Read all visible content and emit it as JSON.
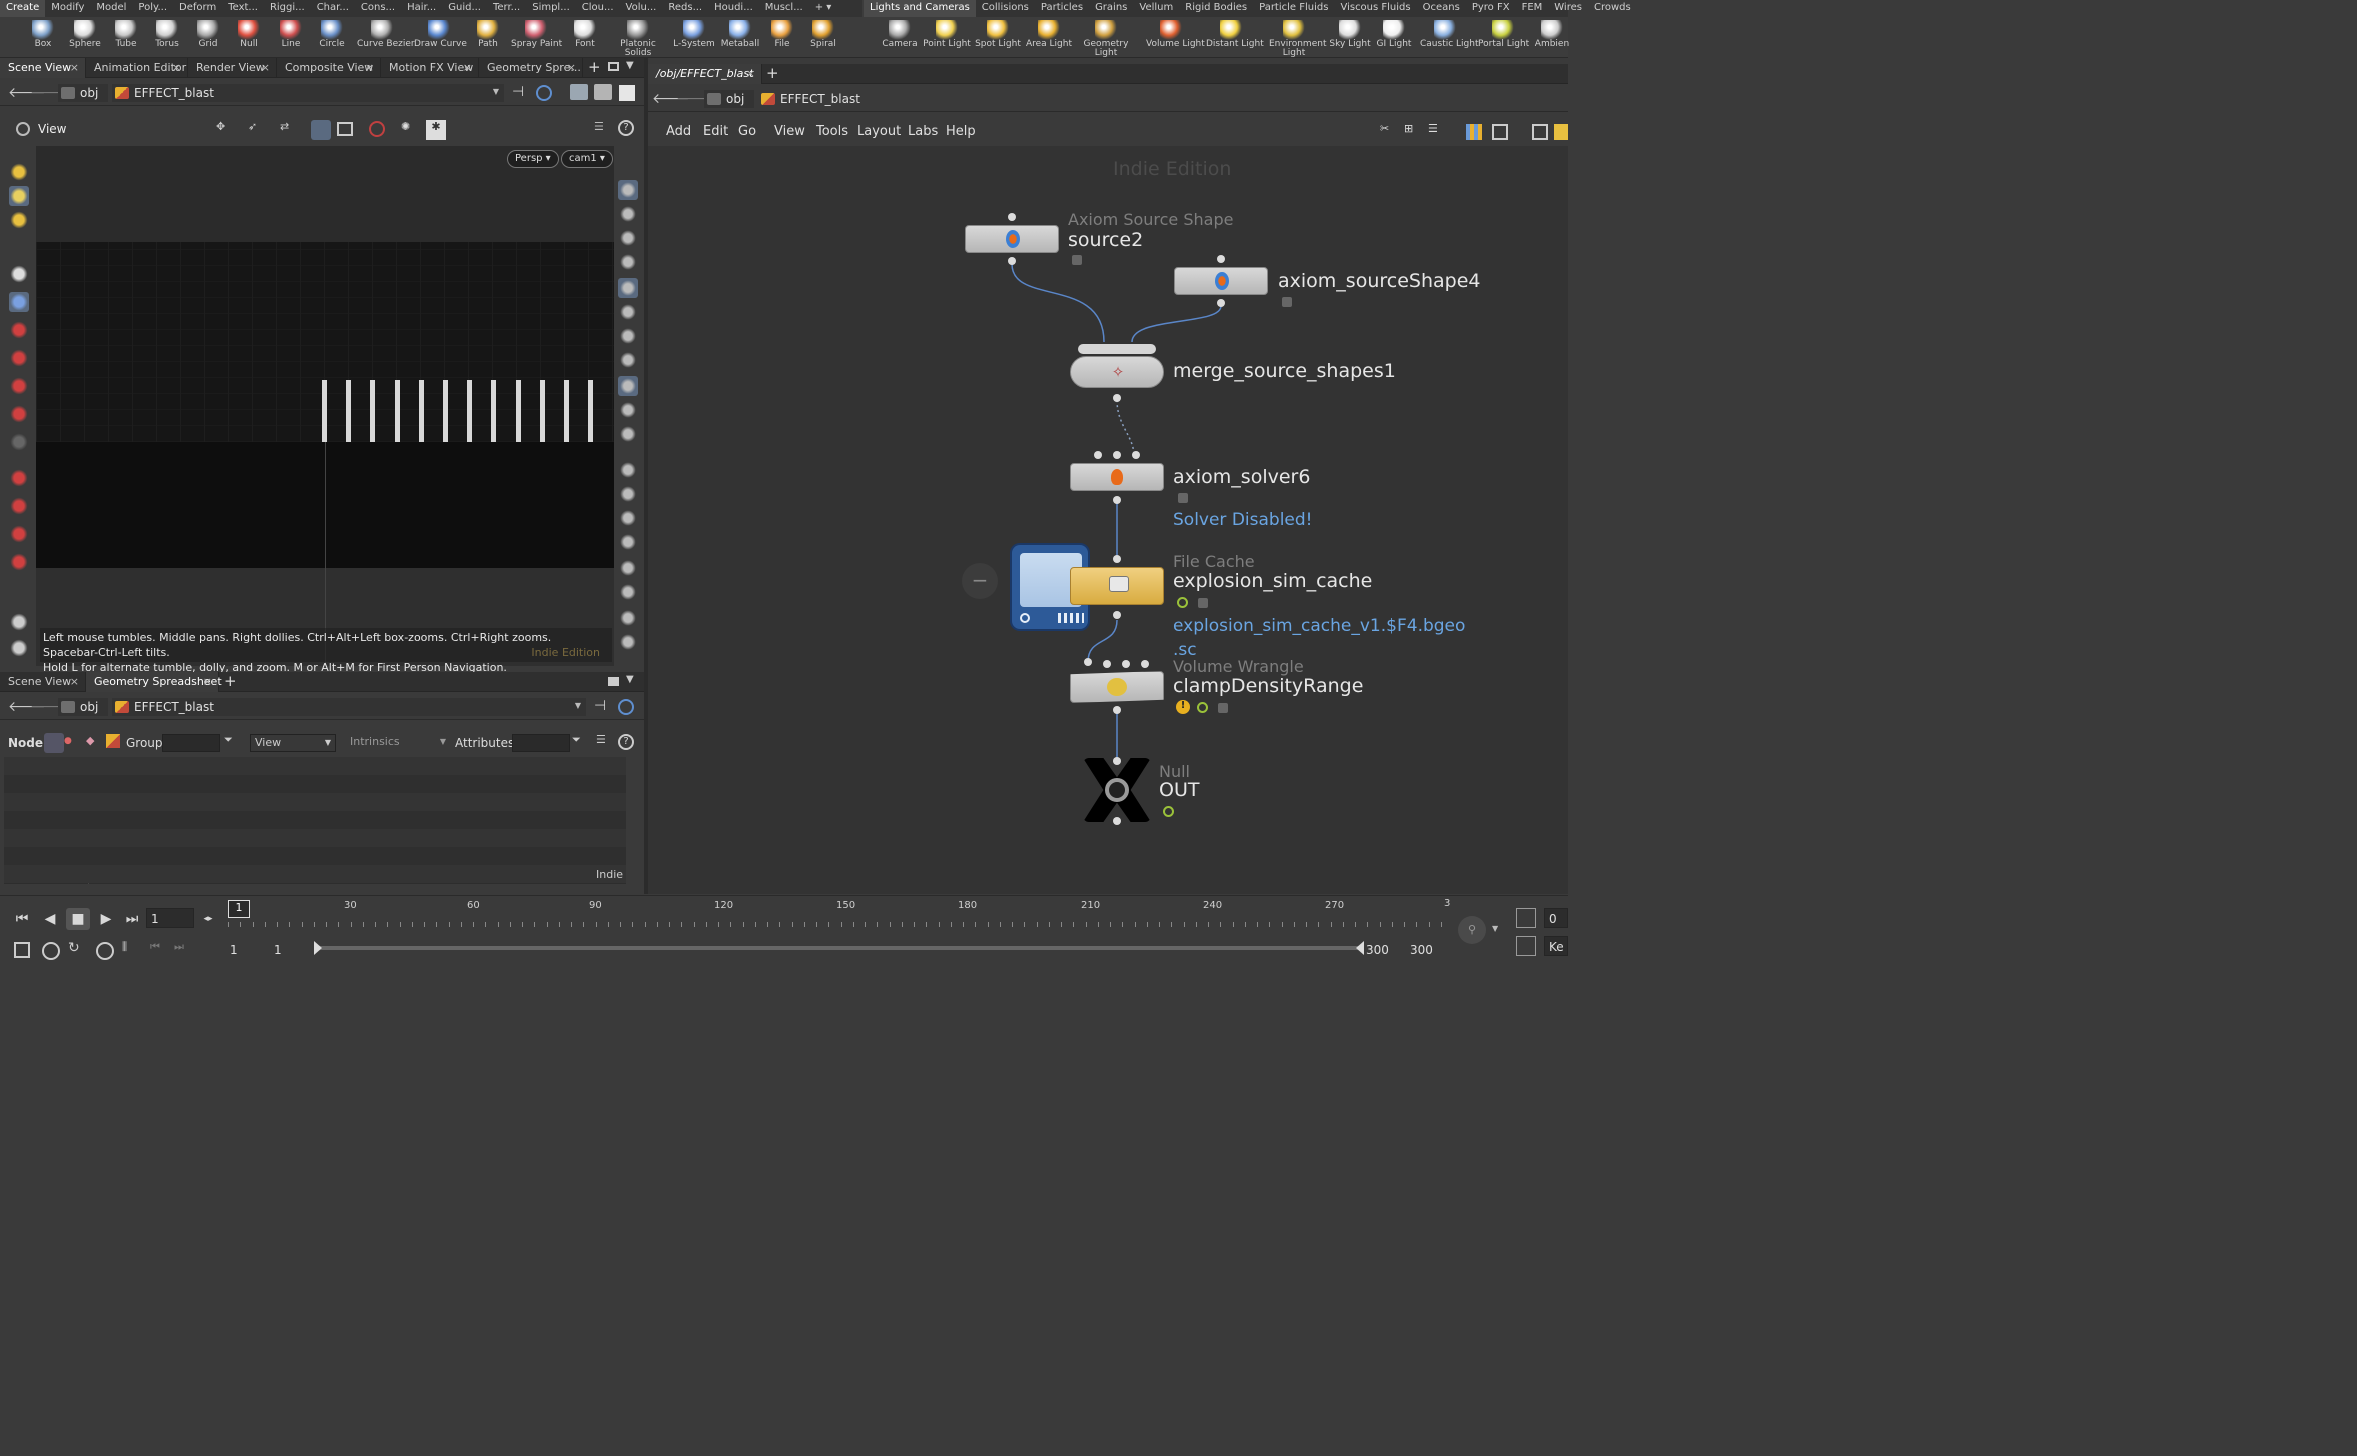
{
  "shelf": {
    "left_tabs": [
      "Create",
      "Modify",
      "Model",
      "Poly...",
      "Deform",
      "Text...",
      "Riggi...",
      "Char...",
      "Cons...",
      "Hair...",
      "Guid...",
      "Terr...",
      "Simpl...",
      "Clou...",
      "Volu...",
      "Reds...",
      "Houdi...",
      "Muscl..."
    ],
    "right_tabs": [
      "Lights and Cameras",
      "Collisions",
      "Particles",
      "Grains",
      "Vellum",
      "Rigid Bodies",
      "Particle Fluids",
      "Viscous Fluids",
      "Oceans",
      "Pyro FX",
      "FEM",
      "Wires",
      "Crowds"
    ],
    "left_tools": [
      "Box",
      "Sphere",
      "Tube",
      "Torus",
      "Grid",
      "Null",
      "Line",
      "Circle",
      "Curve Bezier",
      "Draw Curve",
      "Path",
      "Spray Paint",
      "Font",
      "Platonic Solids",
      "L-System",
      "Metaball",
      "File",
      "Spiral"
    ],
    "right_tools": [
      "Camera",
      "Point Light",
      "Spot Light",
      "Area Light",
      "Geometry Light",
      "Volume Light",
      "Distant Light",
      "Environment Light",
      "Sky Light",
      "GI Light",
      "Caustic Light",
      "Portal Light",
      "Ambien"
    ]
  },
  "scene_pane": {
    "tabs": [
      "Scene View",
      "Animation Editor",
      "Render View",
      "Composite View",
      "Motion FX View",
      "Geometry Spre..."
    ],
    "path_obj": "obj",
    "path_node": "EFFECT_blast",
    "toolbar_title": "View",
    "camera_persp": "Persp",
    "camera_name": "cam1",
    "hud_line1": "Left mouse tumbles. Middle pans. Right dollies. Ctrl+Alt+Left box-zooms. Ctrl+Right zooms. Spacebar-Ctrl-Left tilts.",
    "hud_line2": "Hold L for alternate tumble, dolly, and zoom.    M or Alt+M for First Person Navigation.",
    "hud_edition": "Indie Edition"
  },
  "sheet_pane": {
    "tabs": [
      "Scene View",
      "Geometry Spreadsheet"
    ],
    "path_obj": "obj",
    "path_node": "EFFECT_blast",
    "node_label": "Node:",
    "group_label": "Group:",
    "view_label": "View",
    "intrinsics_label": "Intrinsics",
    "attributes_label": "Attributes:",
    "footer": "Indie"
  },
  "network_pane": {
    "tab": "/obj/EFFECT_blast",
    "path_obj": "obj",
    "path_node": "EFFECT_blast",
    "menus": [
      "Add",
      "Edit",
      "Go",
      "View",
      "Tools",
      "Layout",
      "Labs",
      "Help"
    ],
    "watermark": "Indie Edition",
    "nodes": {
      "source2": {
        "type": "Axiom Source Shape",
        "name": "source2"
      },
      "source4": {
        "name": "axiom_sourceShape4"
      },
      "merge": {
        "name": "merge_source_shapes1"
      },
      "solver": {
        "name": "axiom_solver6",
        "info": "Solver Disabled!"
      },
      "cache": {
        "type": "File Cache",
        "name": "explosion_sim_cache",
        "info": "explosion_sim_cache_v1.$F4.bgeo",
        "info2": ".sc"
      },
      "wrangle": {
        "type": "Volume Wrangle",
        "name": "clampDensityRange"
      },
      "out": {
        "type": "Null",
        "name": "OUT"
      }
    }
  },
  "timeline": {
    "current_frame": "1",
    "marker": "1",
    "ticks": [
      "30",
      "60",
      "90",
      "120",
      "150",
      "180",
      "210",
      "240",
      "270"
    ],
    "range_start_a": "1",
    "range_start_b": "1",
    "range_end_a": "300",
    "range_end_b": "300",
    "right_value": "0",
    "right_key": "Ke"
  }
}
